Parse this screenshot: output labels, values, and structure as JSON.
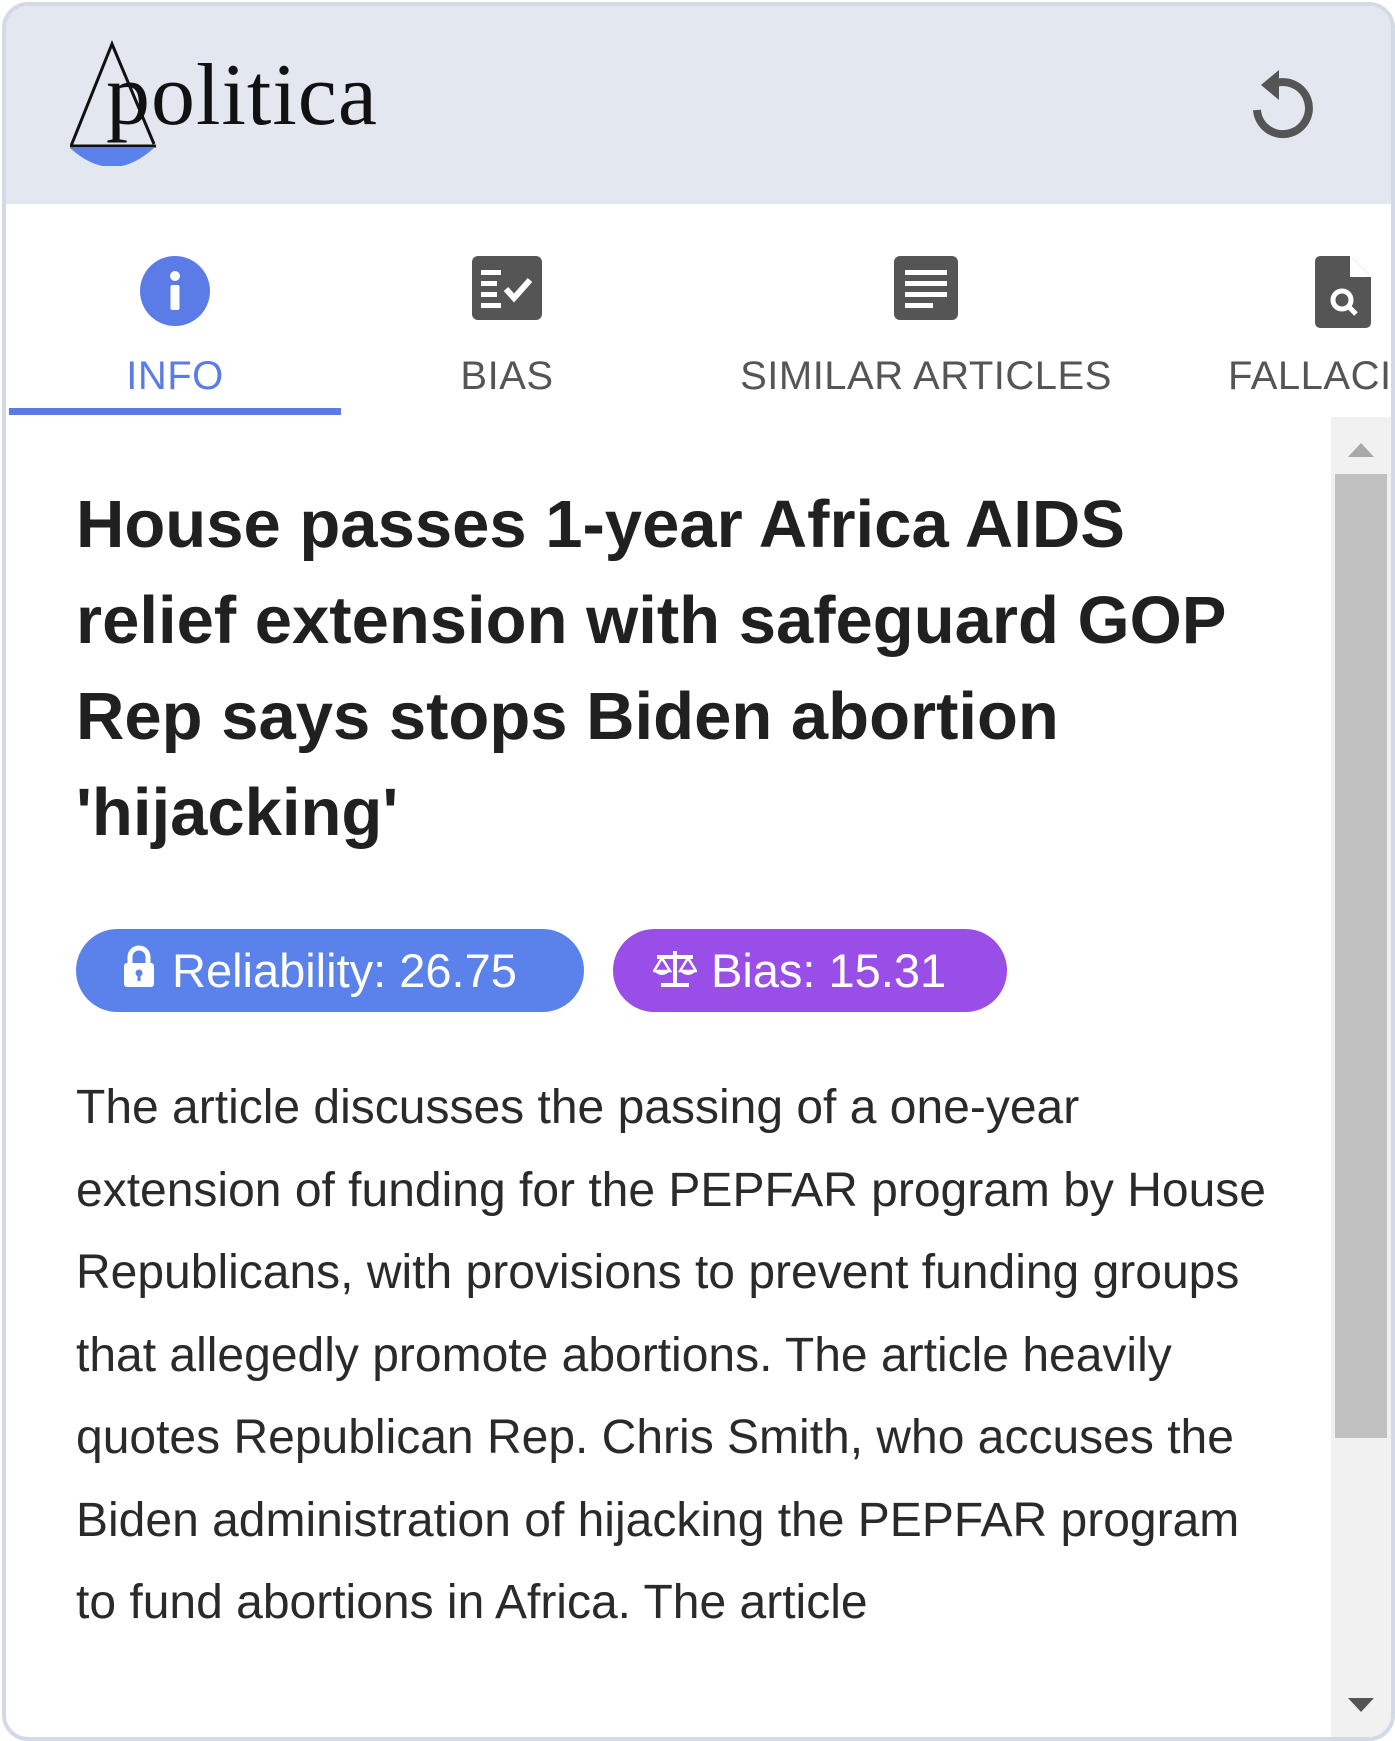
{
  "app": {
    "logo_text": "politica",
    "refresh_icon": "refresh-icon"
  },
  "tabs": [
    {
      "label": "INFO",
      "icon": "info-circle-icon",
      "active": true
    },
    {
      "label": "BIAS",
      "icon": "checklist-icon",
      "active": false
    },
    {
      "label": "SIMILAR ARTICLES",
      "icon": "document-icon",
      "active": false
    },
    {
      "label": "FALLACI",
      "icon": "file-search-icon",
      "active": false
    }
  ],
  "article": {
    "title": "House passes 1-year Africa AIDS relief extension with safeguard GOP Rep says stops Biden abortion 'hijacking'",
    "reliability": {
      "label": "Reliability: 26.75",
      "value": 26.75,
      "icon": "lock-icon",
      "color": "#5b82ea"
    },
    "bias": {
      "label": "Bias: 15.31",
      "value": 15.31,
      "icon": "scale-icon",
      "color": "#9a4ee8"
    },
    "summary": "The article discusses the passing of a one-year extension of funding for the PEPFAR program by House Republicans, with provisions to prevent funding groups that allegedly promote abortions. The article heavily quotes Republican Rep. Chris Smith, who accuses the Biden administration of hijacking the PEPFAR program to fund abortions in Africa. The article"
  },
  "colors": {
    "accent": "#5b7be6",
    "header_bg": "#e3e7ef",
    "icon_gray": "#555555"
  }
}
